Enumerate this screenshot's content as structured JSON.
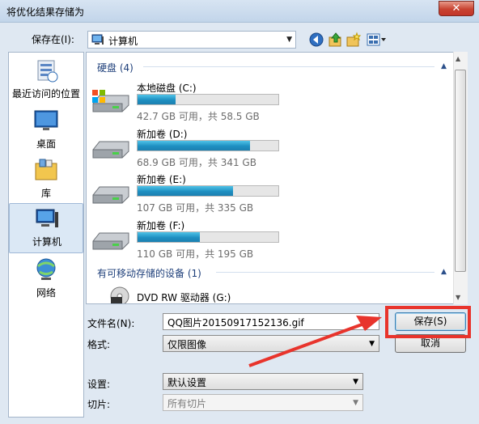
{
  "window": {
    "title": "将优化结果存储为",
    "close_glyph": "✕"
  },
  "location": {
    "label": "保存在(I):",
    "value": "计算机",
    "arrow": "▼"
  },
  "toolbar": {
    "icons": [
      "back-icon",
      "up-folder-icon",
      "new-folder-icon",
      "view-menu-icon"
    ]
  },
  "places": [
    {
      "label": "最近访问的位置",
      "icon": "recent-places-icon"
    },
    {
      "label": "桌面",
      "icon": "desktop-icon"
    },
    {
      "label": "库",
      "icon": "library-icon"
    },
    {
      "label": "计算机",
      "icon": "computer-icon",
      "selected": true
    },
    {
      "label": "网络",
      "icon": "network-icon"
    }
  ],
  "groups": {
    "hdd": {
      "label": "硬盘 (4)",
      "caret": "▲"
    },
    "removable": {
      "label": "有可移动存储的设备 (1)",
      "caret": "▲"
    }
  },
  "drives": [
    {
      "name": "本地磁盘 (C:)",
      "size": "42.7 GB 可用，共 58.5 GB",
      "used_fraction": 0.27
    },
    {
      "name": "新加卷 (D:)",
      "size": "68.9 GB 可用，共 341 GB",
      "used_fraction": 0.8
    },
    {
      "name": "新加卷 (E:)",
      "size": "107 GB 可用，共 335 GB",
      "used_fraction": 0.68
    },
    {
      "name": "新加卷 (F:)",
      "size": "110 GB 可用，共 195 GB",
      "used_fraction": 0.44
    }
  ],
  "dvd": {
    "name": "DVD RW 驱动器 (G:)"
  },
  "form": {
    "filename_label": "文件名(N):",
    "filename_value": "QQ图片20150917152136.gif",
    "format_label": "格式:",
    "format_value": "仅限图像",
    "settings_label": "设置:",
    "settings_value": "默认设置",
    "slices_label": "切片:",
    "slices_value": "所有切片",
    "arrow": "▼"
  },
  "buttons": {
    "save": "保存(S)",
    "cancel": "取消"
  },
  "annotation": {
    "highlight_color": "#e8342c"
  },
  "scroll": {
    "up": "▲",
    "down": "▼"
  }
}
